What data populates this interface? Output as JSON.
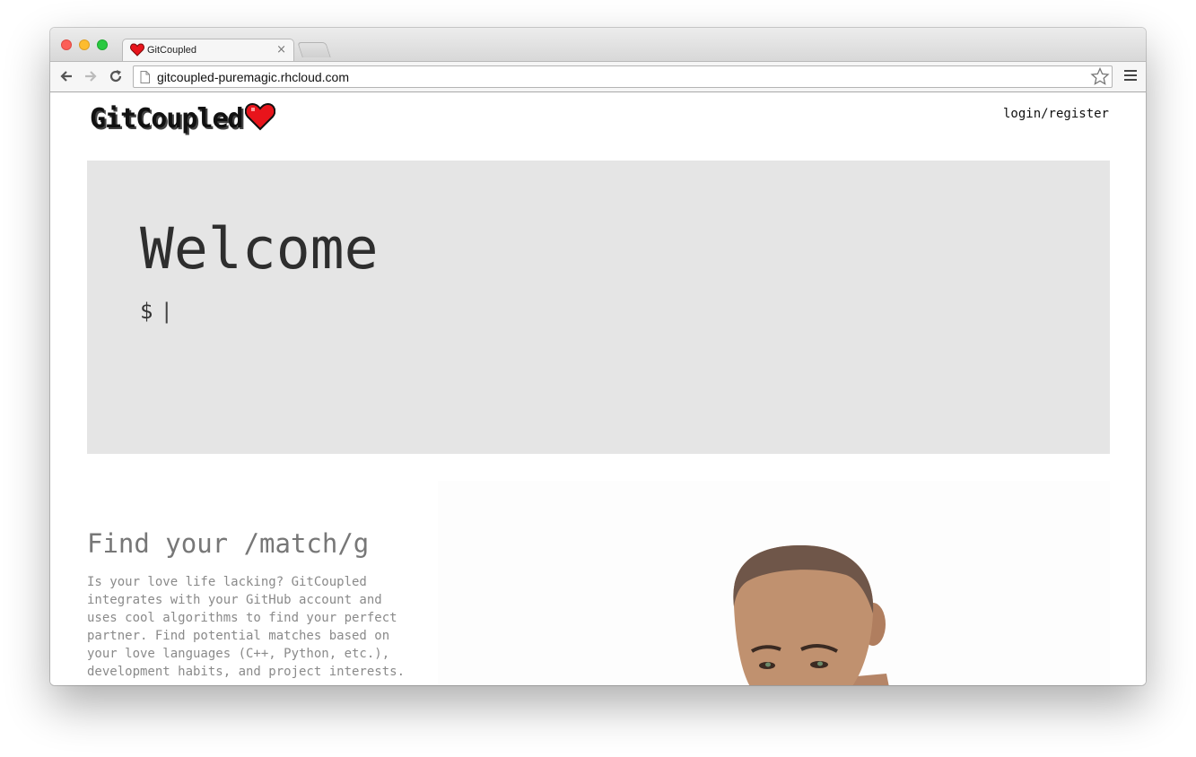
{
  "browser": {
    "tab_title": "GitCoupled",
    "tab_close": "×",
    "url": "gitcoupled-puremagic.rhcloud.com"
  },
  "header": {
    "logo_text": "GitCoupled",
    "login_link": "login/register"
  },
  "hero": {
    "title": "Welcome",
    "prompt": "$",
    "cursor": "|"
  },
  "feature": {
    "heading": "Find your /match/g",
    "body": "Is your love life lacking? GitCoupled integrates with your GitHub account and uses cool algorithms to find your perfect partner. Find potential matches based on your love languages (C++, Python, etc.), development habits, and project interests."
  },
  "colors": {
    "heart": "#e8141b",
    "hero_bg": "#e5e5e5"
  },
  "icons": [
    "heart-icon",
    "back-arrow-icon",
    "forward-arrow-icon",
    "reload-icon",
    "page-icon",
    "star-icon",
    "menu-icon"
  ]
}
